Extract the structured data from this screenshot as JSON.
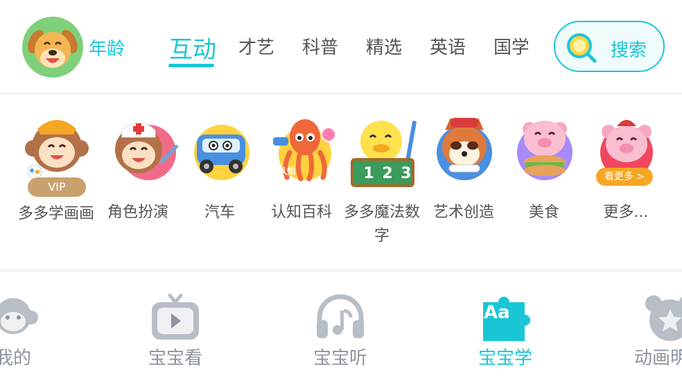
{
  "header": {
    "age_label": "年龄",
    "tabs": [
      {
        "label": "互动",
        "active": true
      },
      {
        "label": "才艺",
        "active": false
      },
      {
        "label": "科普",
        "active": false
      },
      {
        "label": "精选",
        "active": false
      },
      {
        "label": "英语",
        "active": false
      },
      {
        "label": "国学",
        "active": false
      }
    ],
    "search_label": "搜索"
  },
  "categories": [
    {
      "label": "多多学画画",
      "icon": "monkey-painter-icon",
      "badge": "VIP"
    },
    {
      "label": "角色扮演",
      "icon": "monkey-nurse-icon"
    },
    {
      "label": "汽车",
      "icon": "car-icon"
    },
    {
      "label": "认知百科",
      "icon": "octopus-icon",
      "tag": "认知"
    },
    {
      "label": "多多魔法数字",
      "icon": "duck-numbers-icon",
      "number_text": "1 2 3"
    },
    {
      "label": "艺术创造",
      "icon": "raccoon-icon"
    },
    {
      "label": "美食",
      "icon": "pig-chef-icon"
    },
    {
      "label": "更多...",
      "icon": "pig-more-icon",
      "badge": "看更多 >"
    }
  ],
  "bottom_nav": [
    {
      "label": "我的",
      "icon": "monkey-face-icon",
      "active": false
    },
    {
      "label": "宝宝看",
      "icon": "tv-play-icon",
      "active": false
    },
    {
      "label": "宝宝听",
      "icon": "headphones-icon",
      "active": false
    },
    {
      "label": "宝宝学",
      "icon": "puzzle-aa-icon",
      "icon_text": "Aa",
      "active": true
    },
    {
      "label": "动画明星",
      "icon": "bear-star-icon",
      "active": false
    }
  ],
  "colors": {
    "accent": "#19c6d6",
    "text": "#555555",
    "nav_inactive": "#8c95a0"
  }
}
